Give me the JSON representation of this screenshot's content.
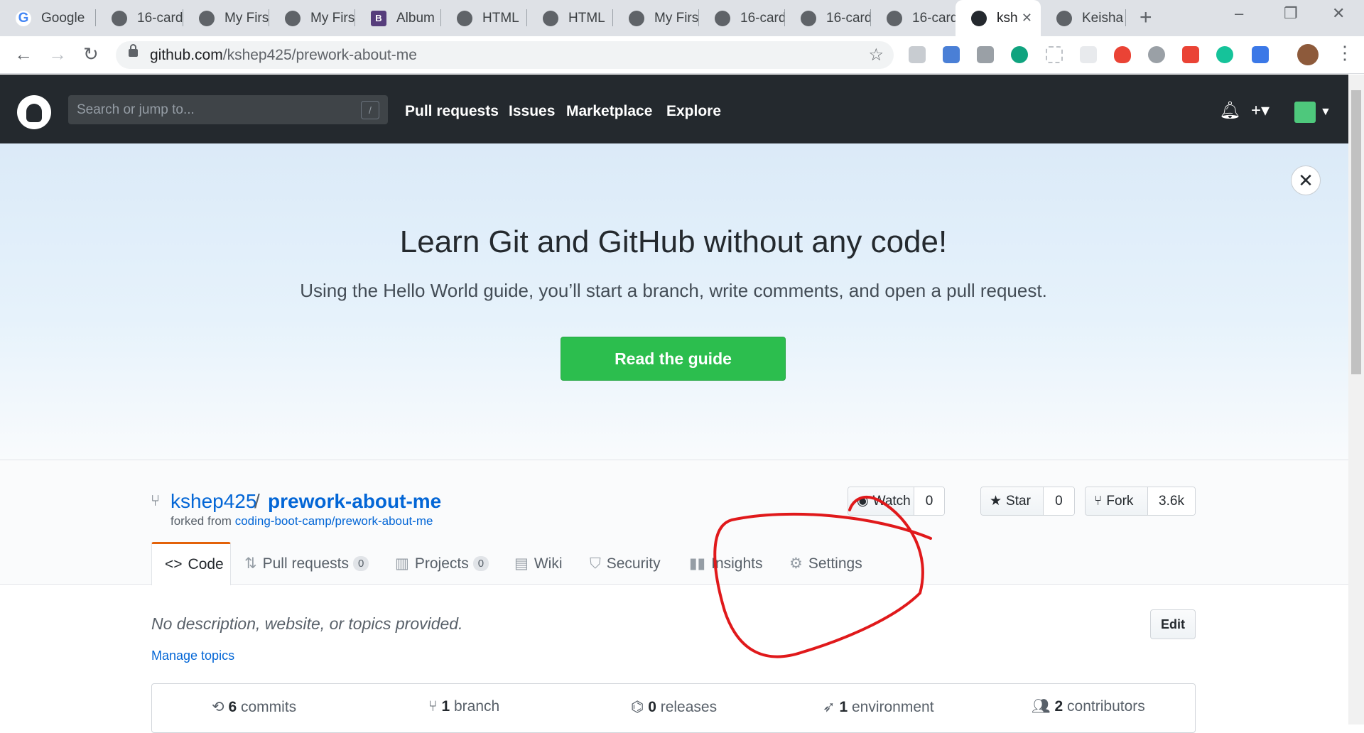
{
  "browser": {
    "tabs": [
      {
        "label": "Google",
        "icon": "google-icon"
      },
      {
        "label": "16-card",
        "icon": "globe-icon"
      },
      {
        "label": "My First",
        "icon": "globe-icon"
      },
      {
        "label": "My First",
        "icon": "globe-icon"
      },
      {
        "label": "Album",
        "icon": "bootstrap-icon"
      },
      {
        "label": "HTML",
        "icon": "globe-icon"
      },
      {
        "label": "HTML",
        "icon": "globe-icon"
      },
      {
        "label": "My First",
        "icon": "globe-icon"
      },
      {
        "label": "16-card",
        "icon": "globe-icon"
      },
      {
        "label": "16-card",
        "icon": "globe-icon"
      },
      {
        "label": "16-card",
        "icon": "globe-icon"
      },
      {
        "label": "ksh",
        "icon": "github-icon",
        "active": true
      },
      {
        "label": "Keisha",
        "icon": "globe-icon"
      }
    ],
    "url_host": "github.com",
    "url_path": "/kshep425/prework-about-me"
  },
  "github": {
    "search_placeholder": "Search or jump to...",
    "search_shortcut": "/",
    "nav": [
      "Pull requests",
      "Issues",
      "Marketplace",
      "Explore"
    ]
  },
  "banner": {
    "title": "Learn Git and GitHub without any code!",
    "subtitle": "Using the Hello World guide, you’ll start a branch, write comments, and open a pull request.",
    "button": "Read the guide",
    "button_color": "#2cbe4e"
  },
  "repo": {
    "owner": "kshep425",
    "separator": "/",
    "name": "prework-about-me",
    "forked_prefix": "forked from",
    "forked_source": "coding-boot-camp/prework-about-me",
    "watch_label": "Watch",
    "watch_count": "0",
    "star_label": "Star",
    "star_count": "0",
    "fork_label": "Fork",
    "fork_count": "3.6k",
    "tabs": [
      {
        "label": "Code",
        "icon": "code-icon"
      },
      {
        "label": "Pull requests",
        "count": "0",
        "icon": "pull-request-icon"
      },
      {
        "label": "Projects",
        "count": "0",
        "icon": "project-icon"
      },
      {
        "label": "Wiki",
        "icon": "book-icon"
      },
      {
        "label": "Security",
        "icon": "shield-icon"
      },
      {
        "label": "Insights",
        "icon": "graph-icon"
      },
      {
        "label": "Settings",
        "icon": "gear-icon"
      }
    ],
    "description": "No description, website, or topics provided.",
    "manage_topics": "Manage topics",
    "edit_label": "Edit",
    "summary": [
      {
        "count": "6",
        "label": "commits",
        "icon": "history-icon"
      },
      {
        "count": "1",
        "label": "branch",
        "icon": "branch-icon"
      },
      {
        "count": "0",
        "label": "releases",
        "icon": "tag-icon"
      },
      {
        "count": "1",
        "label": "environment",
        "icon": "rocket-icon"
      },
      {
        "count": "2",
        "label": "contributors",
        "icon": "people-icon"
      }
    ]
  },
  "colors": {
    "header": "#24292e",
    "link": "#0366d6",
    "annotation": "#e0191b"
  }
}
